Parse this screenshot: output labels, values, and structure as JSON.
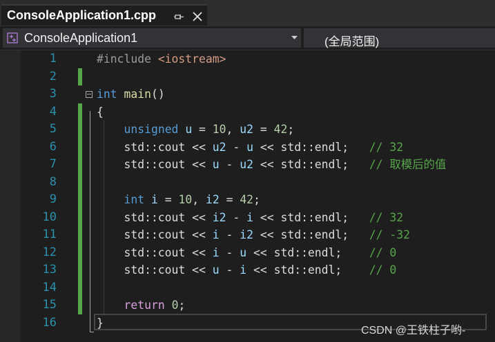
{
  "tab": {
    "title": "ConsoleApplication1.cpp",
    "pin_icon": "pin-icon",
    "close_icon": "close-icon"
  },
  "navbar": {
    "project": "ConsoleApplication1",
    "scope": "(全局范围)",
    "project_icon": "cpp-project-icon",
    "arrow_icon": "chevron-down-icon"
  },
  "editor": {
    "lines": [
      {
        "n": "1",
        "tokens": [
          [
            "pre",
            "#include "
          ],
          [
            "inc",
            "<iostream>"
          ]
        ]
      },
      {
        "n": "2",
        "tokens": []
      },
      {
        "n": "3",
        "tokens": [
          [
            "kw",
            "int"
          ],
          [
            "pl",
            " "
          ],
          [
            "fn",
            "main"
          ],
          [
            "pl",
            "()"
          ]
        ]
      },
      {
        "n": "4",
        "tokens": [
          [
            "pl",
            "{"
          ]
        ]
      },
      {
        "n": "5",
        "tokens": [
          [
            "pl",
            "    "
          ],
          [
            "kw",
            "unsigned"
          ],
          [
            "pl",
            " "
          ],
          [
            "var",
            "u"
          ],
          [
            "pl",
            " = "
          ],
          [
            "num",
            "10"
          ],
          [
            "pl",
            ", "
          ],
          [
            "var",
            "u2"
          ],
          [
            "pl",
            " = "
          ],
          [
            "num",
            "42"
          ],
          [
            "pl",
            ";"
          ]
        ]
      },
      {
        "n": "6",
        "tokens": [
          [
            "pl",
            "    std::cout << "
          ],
          [
            "var",
            "u2"
          ],
          [
            "pl",
            " - "
          ],
          [
            "var",
            "u"
          ],
          [
            "pl",
            " << std::endl;   "
          ],
          [
            "cm",
            "// 32"
          ]
        ]
      },
      {
        "n": "7",
        "tokens": [
          [
            "pl",
            "    std::cout << "
          ],
          [
            "var",
            "u"
          ],
          [
            "pl",
            " - "
          ],
          [
            "var",
            "u2"
          ],
          [
            "pl",
            " << std::endl;   "
          ],
          [
            "cm",
            "// 取模后的值"
          ]
        ]
      },
      {
        "n": "8",
        "tokens": []
      },
      {
        "n": "9",
        "tokens": [
          [
            "pl",
            "    "
          ],
          [
            "kw",
            "int"
          ],
          [
            "pl",
            " "
          ],
          [
            "var",
            "i"
          ],
          [
            "pl",
            " = "
          ],
          [
            "num",
            "10"
          ],
          [
            "pl",
            ", "
          ],
          [
            "var",
            "i2"
          ],
          [
            "pl",
            " = "
          ],
          [
            "num",
            "42"
          ],
          [
            "pl",
            ";"
          ]
        ]
      },
      {
        "n": "10",
        "tokens": [
          [
            "pl",
            "    std::cout << "
          ],
          [
            "var",
            "i2"
          ],
          [
            "pl",
            " - "
          ],
          [
            "var",
            "i"
          ],
          [
            "pl",
            " << std::endl;   "
          ],
          [
            "cm",
            "// 32"
          ]
        ]
      },
      {
        "n": "11",
        "tokens": [
          [
            "pl",
            "    std::cout << "
          ],
          [
            "var",
            "i"
          ],
          [
            "pl",
            " - "
          ],
          [
            "var",
            "i2"
          ],
          [
            "pl",
            " << std::endl;   "
          ],
          [
            "cm",
            "// -32"
          ]
        ]
      },
      {
        "n": "12",
        "tokens": [
          [
            "pl",
            "    std::cout << "
          ],
          [
            "var",
            "i"
          ],
          [
            "pl",
            " - "
          ],
          [
            "var",
            "u"
          ],
          [
            "pl",
            " << std::endl;    "
          ],
          [
            "cm",
            "// 0"
          ]
        ]
      },
      {
        "n": "13",
        "tokens": [
          [
            "pl",
            "    std::cout << "
          ],
          [
            "var",
            "u"
          ],
          [
            "pl",
            " - "
          ],
          [
            "var",
            "i"
          ],
          [
            "pl",
            " << std::endl;    "
          ],
          [
            "cm",
            "// 0"
          ]
        ]
      },
      {
        "n": "14",
        "tokens": []
      },
      {
        "n": "15",
        "tokens": [
          [
            "pl",
            "    "
          ],
          [
            "ret",
            "return"
          ],
          [
            "pl",
            " "
          ],
          [
            "num",
            "0"
          ],
          [
            "pl",
            ";"
          ]
        ]
      },
      {
        "n": "16",
        "tokens": [
          [
            "pl",
            "}"
          ]
        ]
      }
    ]
  },
  "watermark": "CSDN @王铁柱子哟-",
  "colors": {
    "line_number": "#2b91af",
    "keyword": "#569cd6",
    "comment": "#57a64a",
    "number": "#b5cea8",
    "change_bar": "#57a64a"
  }
}
